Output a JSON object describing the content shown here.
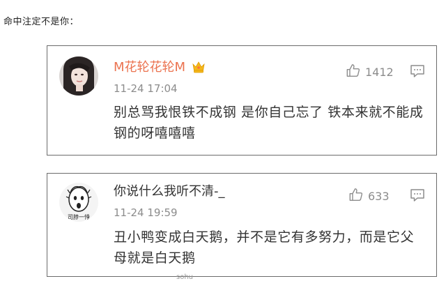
{
  "page": {
    "caption": "命中注定不是你："
  },
  "comments": [
    {
      "username": "M花轮花轮M",
      "timestamp": "11-24 17:04",
      "content": "别总骂我恨铁不成钢 是你自己忘了 铁本来就不能成钢的呀嘻嘻嘻",
      "likes": "1412",
      "username_color": "#eb7350",
      "badge_icon": "crown-vip-icon"
    },
    {
      "username": "你说什么我听不清-_",
      "timestamp": "11-24 19:59",
      "content": "丑小鸭变成白天鹅，并不是它有多努力，而是它父母就是白天鹅",
      "likes": "633",
      "avatar_text": "司脖一悸"
    }
  ],
  "footer": {
    "mark": "sohu"
  },
  "colors": {
    "accent": "#eb7350",
    "muted": "#8c8c8c",
    "text": "#333333",
    "border": "#6b6b6b"
  }
}
